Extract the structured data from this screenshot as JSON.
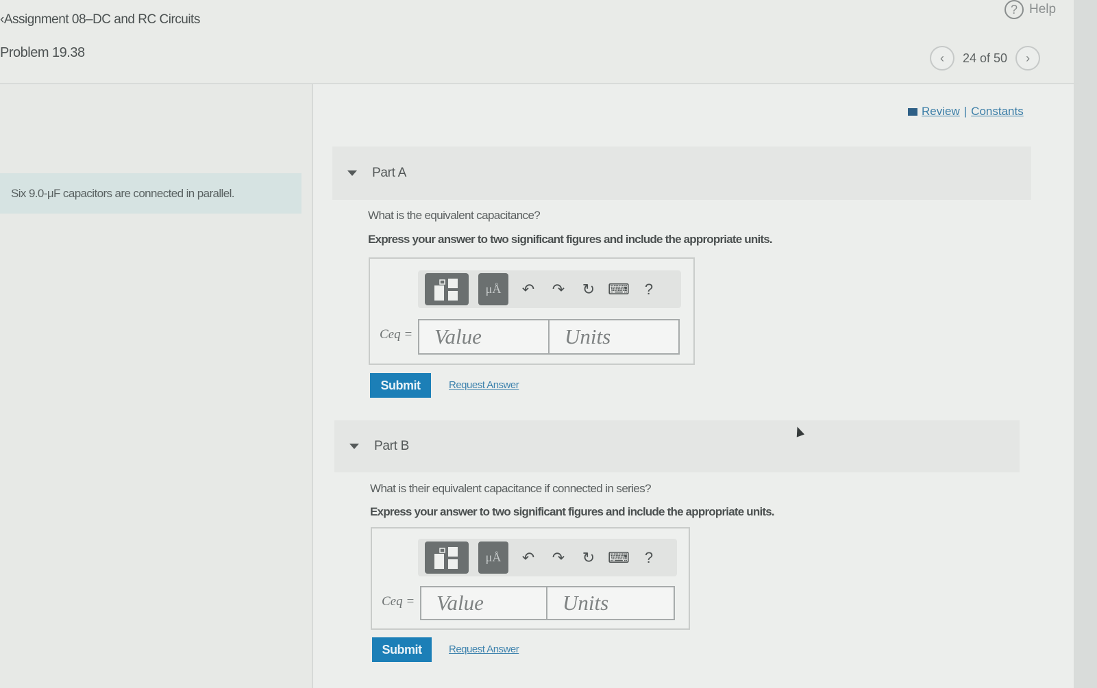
{
  "header": {
    "assignment_title": "Assignment 08–DC and RC Circuits",
    "problem_title": "Problem 19.38",
    "help_label": "Help",
    "help_glyph": "?",
    "pager_text": "24 of 50",
    "prev_glyph": "‹",
    "next_glyph": "›"
  },
  "intro_text": "Six 9.0-μF capacitors are connected in parallel.",
  "links": {
    "review": "Review",
    "separator": "|",
    "constants": "Constants"
  },
  "toolbar": {
    "unit_symbol": "μÅ",
    "undo": "↶",
    "redo": "↷",
    "reset": "↻",
    "keyboard": "⌨",
    "help": "?"
  },
  "parts": [
    {
      "label": "Part A",
      "question": "What is the equivalent capacitance?",
      "instruction": "Express your answer to two significant figures and include the appropriate units.",
      "variable": "Ceq =",
      "value_placeholder": "Value",
      "units_placeholder": "Units",
      "submit": "Submit",
      "request": "Request Answer"
    },
    {
      "label": "Part B",
      "question": "What is their equivalent capacitance if connected in series?",
      "instruction": "Express your answer to two significant figures and include the appropriate units.",
      "variable": "Ceq =",
      "value_placeholder": "Value",
      "units_placeholder": "Units",
      "submit": "Submit",
      "request": "Request Answer"
    }
  ]
}
